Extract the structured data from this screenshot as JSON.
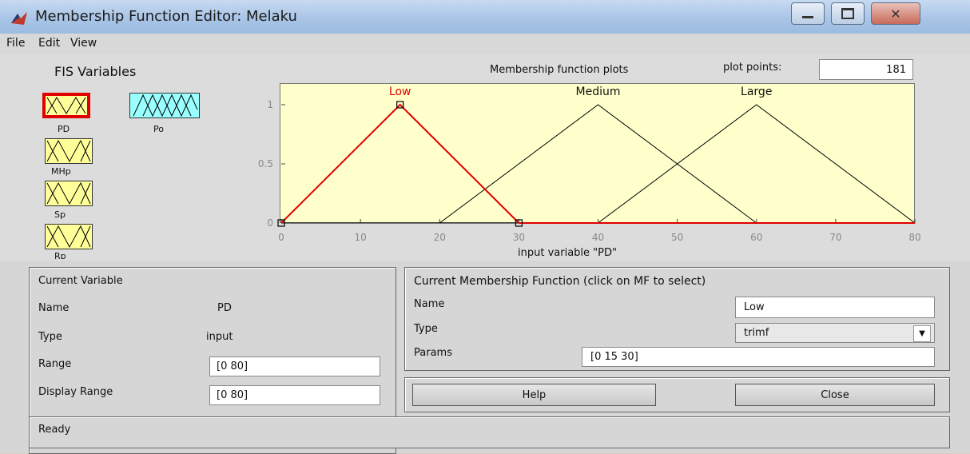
{
  "window": {
    "title": "Membership Function Editor: Melaku"
  },
  "menu": [
    "File",
    "Edit",
    "View"
  ],
  "fis": {
    "title": "FIS Variables",
    "variables": [
      {
        "label": "PD",
        "kind": "input",
        "selected": true
      },
      {
        "label": "Po",
        "kind": "output",
        "selected": false
      },
      {
        "label": "MHp",
        "kind": "input",
        "selected": false
      },
      {
        "label": "Sp",
        "kind": "input",
        "selected": false
      },
      {
        "label": "Rp",
        "kind": "input",
        "selected": false
      }
    ]
  },
  "plot": {
    "title": "Membership function plots",
    "plot_points_label": "plot points:",
    "plot_points_value": "181"
  },
  "chart_data": {
    "type": "line",
    "xlabel": "input variable \"PD\"",
    "ylabel": "",
    "xlim": [
      0,
      80
    ],
    "ylim": [
      0,
      1
    ],
    "x_ticks": [
      "0",
      "10",
      "20",
      "30",
      "40",
      "50",
      "60",
      "70",
      "80"
    ],
    "y_ticks": [
      "0",
      "0.5",
      "1"
    ],
    "series": [
      {
        "name": "Low",
        "points": [
          [
            0,
            0
          ],
          [
            15,
            1
          ],
          [
            30,
            0
          ]
        ],
        "selected": true,
        "color": "#e00000"
      },
      {
        "name": "Medium",
        "points": [
          [
            20,
            0
          ],
          [
            40,
            1
          ],
          [
            60,
            0
          ]
        ],
        "selected": false,
        "color": "#000000"
      },
      {
        "name": "Large",
        "points": [
          [
            40,
            0
          ],
          [
            60,
            1
          ],
          [
            80,
            0
          ]
        ],
        "selected": false,
        "color": "#000000"
      }
    ]
  },
  "current_variable": {
    "title": "Current Variable",
    "name_label": "Name",
    "name_value": "PD",
    "type_label": "Type",
    "type_value": "input",
    "range_label": "Range",
    "range_value": "[0 80]",
    "display_range_label": "Display Range",
    "display_range_value": "[0 80]"
  },
  "current_mf": {
    "title": "Current Membership Function (click on MF to select)",
    "name_label": "Name",
    "name_value": "Low",
    "type_label": "Type",
    "type_value": "trimf",
    "params_label": "Params",
    "params_value": "[0 15 30]"
  },
  "buttons": {
    "help": "Help",
    "close": "Close"
  },
  "status": "Ready",
  "colors": {
    "plot_background": "#ffffcc",
    "selected_mf": "#e00000",
    "input_var_fill": "#ffff99",
    "output_var_fill": "#99ffff",
    "selected_var_border": "#e00000"
  }
}
